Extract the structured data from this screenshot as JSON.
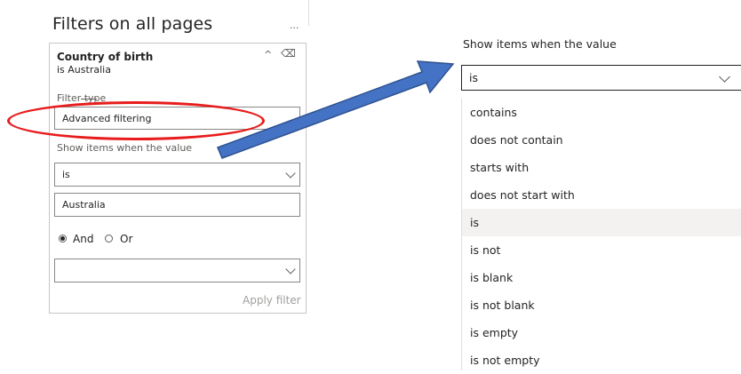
{
  "filter_pane": {
    "title": "Filters on all pages",
    "more": "...",
    "card": {
      "field": "Country of birth",
      "summary": "is Australia",
      "filter_type_label": "Filter type",
      "filter_type_value": "Advanced filtering",
      "show_items_label": "Show items when the value",
      "condition_value": "is",
      "value_input": "Australia",
      "and_label": "And",
      "or_label": "Or",
      "logic_selected": "And",
      "second_condition_value": "",
      "apply_label": "Apply filter"
    }
  },
  "dropdown": {
    "label": "Show items when the value",
    "selected": "is",
    "options": [
      "contains",
      "does not contain",
      "starts with",
      "does not start with",
      "is",
      "is not",
      "is blank",
      "is not blank",
      "is empty",
      "is not empty"
    ]
  },
  "annotations": {
    "ellipse_color": "#e81c1c",
    "arrow_color": "#4472c4"
  }
}
